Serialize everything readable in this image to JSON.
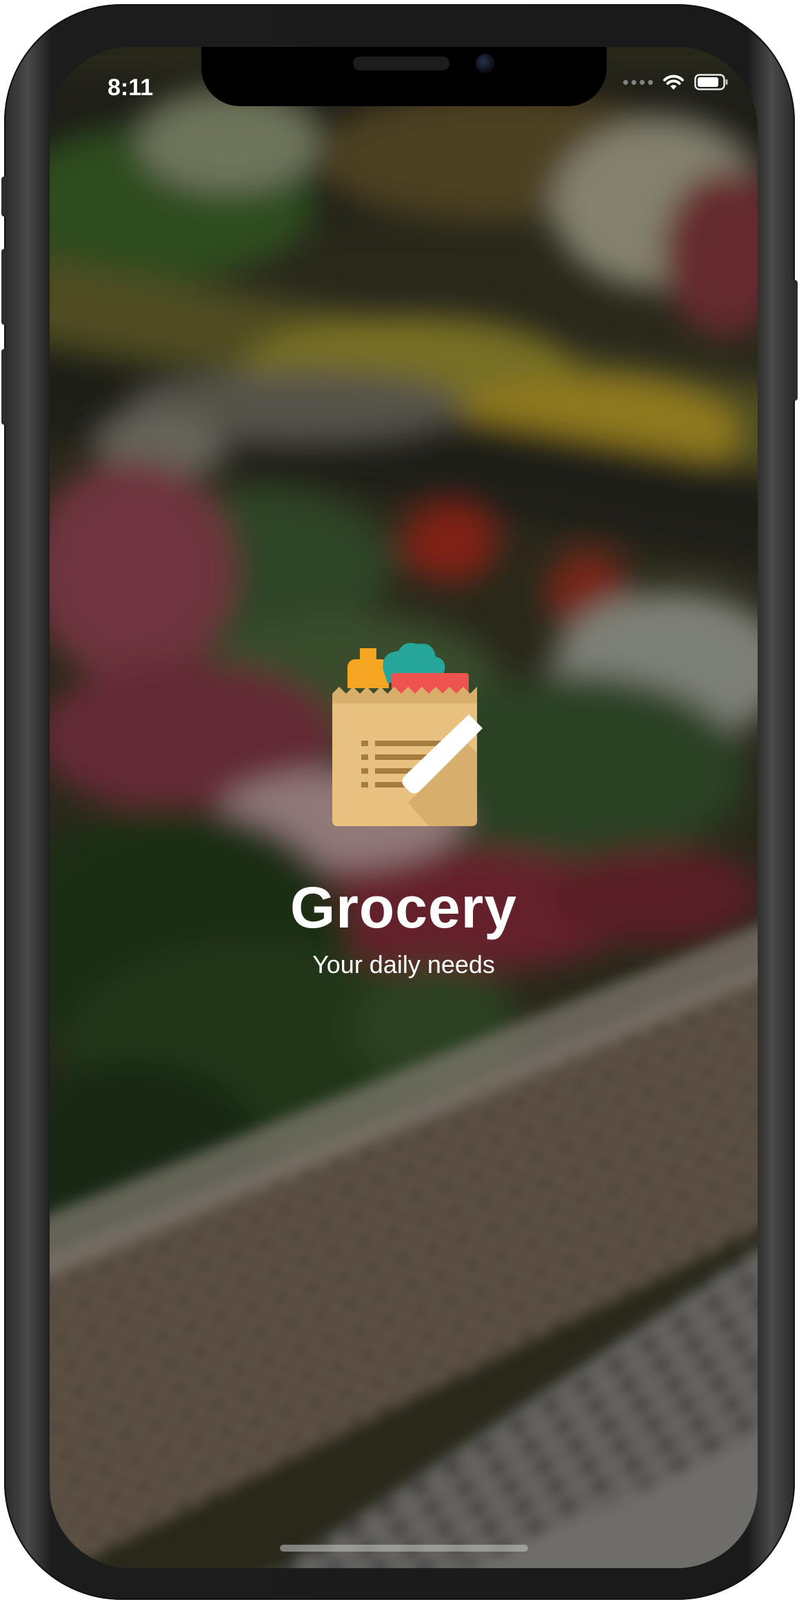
{
  "status_bar": {
    "time": "8:11",
    "wifi_icon": "wifi-icon",
    "battery_icon": "battery-icon"
  },
  "splash": {
    "title": "Grocery",
    "subtitle": "Your daily needs",
    "logo_icon": "grocery-bag-list-icon"
  },
  "colors": {
    "bag": "#E8C07F",
    "bag_fold": "#D9AE6A",
    "list_lines": "#A67C3F",
    "bottle": "#F6A623",
    "leaf": "#26A69A",
    "label_red": "#EF5350",
    "pencil": "#FFFFFF"
  }
}
